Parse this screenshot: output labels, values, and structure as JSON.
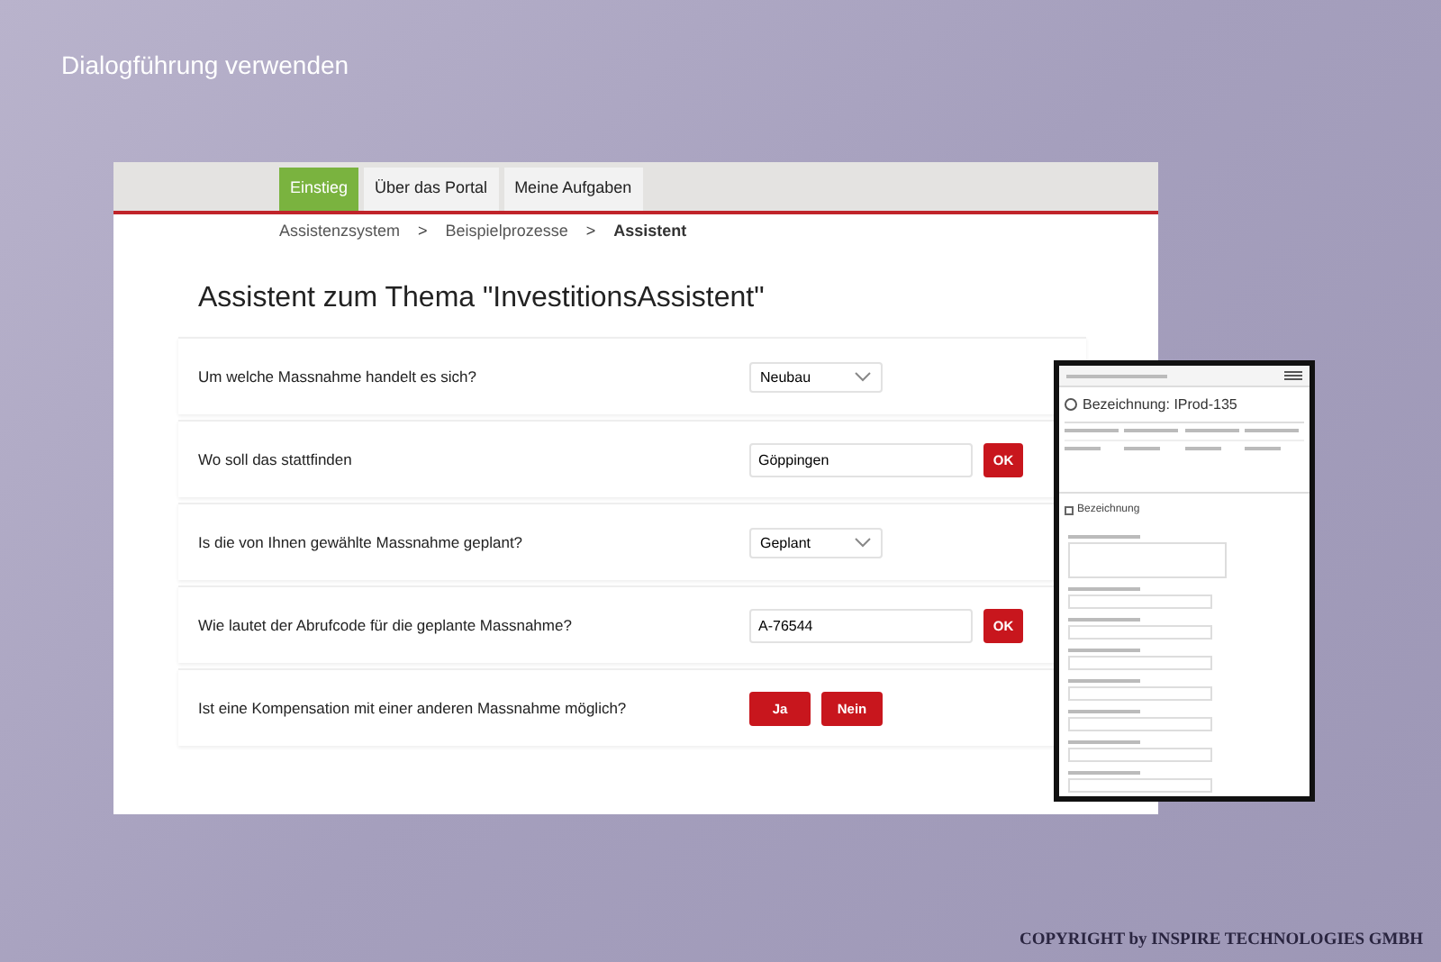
{
  "slide_title": "Dialogführung verwenden",
  "tabs": [
    {
      "label": "Einstieg",
      "selected": true
    },
    {
      "label": "Über das Portal",
      "selected": false
    },
    {
      "label": "Meine Aufgaben",
      "selected": false
    }
  ],
  "breadcrumb": [
    {
      "label": "Assistenzsystem",
      "current": false
    },
    {
      "label": "Beispielprozesse",
      "current": false
    },
    {
      "label": "Assistent",
      "current": true
    }
  ],
  "breadcrumb_separator": ">",
  "heading": "Assistent zum Thema \"InvestitionsAssistent\"",
  "questions": [
    {
      "kind": "select",
      "question": "Um welche Massnahme handelt es sich?",
      "value": "Neubau"
    },
    {
      "kind": "text",
      "question": "Wo soll das stattfinden",
      "value": "Göppingen",
      "button": "OK"
    },
    {
      "kind": "select",
      "question": "Is die von Ihnen gewählte Massnahme geplant?",
      "value": "Geplant"
    },
    {
      "kind": "text",
      "question": "Wie lautet der Abrufcode für die geplante Massnahme?",
      "value": "A-76544",
      "button": "OK"
    },
    {
      "kind": "buttons",
      "question": "Ist eine Kompensation mit einer anderen Massnahme möglich?",
      "buttons": [
        "Ja",
        "Nein"
      ]
    }
  ],
  "phone": {
    "title": "Bezeichnung: IProd-135",
    "section": "Bezeichnung",
    "fields": [
      {
        "kind": "textarea"
      },
      {
        "kind": "input"
      },
      {
        "kind": "input"
      },
      {
        "kind": "input"
      },
      {
        "kind": "input"
      },
      {
        "kind": "input"
      },
      {
        "kind": "input"
      },
      {
        "kind": "input"
      }
    ]
  },
  "copyright": "COPYRIGHT by INSPIRE TECHNOLOGIES GMBH"
}
